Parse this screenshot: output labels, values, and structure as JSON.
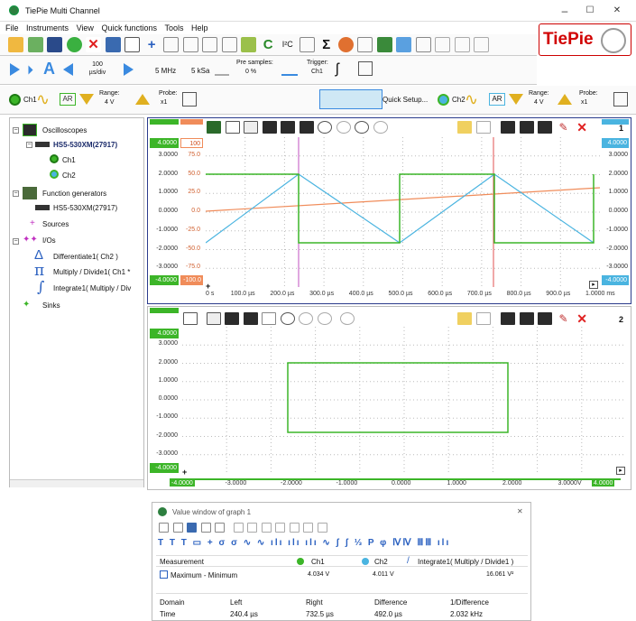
{
  "window": {
    "title": "TiePie Multi Channel",
    "controls": [
      "–",
      "☐",
      "✕"
    ]
  },
  "menu": [
    "File",
    "Instruments",
    "View",
    "Quick functions",
    "Tools",
    "Help"
  ],
  "logo_text": "TiePie",
  "timebase": {
    "record": "100\nµs/div",
    "rate": "5 MHz",
    "samples": "5 kSa",
    "pre_samples_label": "Pre samples:",
    "pre_samples_value": "0 %",
    "trigger_label": "Trigger:",
    "trigger_value": "Ch1"
  },
  "ch1": {
    "name": "Ch1",
    "coupling": "AR",
    "range_label": "Range:",
    "range_value": "4 V",
    "probe_label": "Probe:",
    "probe_value": "x1"
  },
  "ch2": {
    "name": "Ch2",
    "coupling": "AR",
    "range_label": "Range:",
    "range_value": "4 V",
    "probe_label": "Probe:",
    "probe_value": "x1"
  },
  "quick_setup": "Quick Setup...",
  "tree": {
    "oscilloscopes": "Oscilloscopes",
    "device1": "HS5-530XM(27917)",
    "ch1": "Ch1",
    "ch2": "Ch2",
    "function_generators": "Function generators",
    "device2": "HS5-530XM(27917)",
    "sources": "Sources",
    "ios": "I/Os",
    "differentiate": "Differentiate1( Ch2 )",
    "multiply": "Multiply / Divide1( Ch1 *",
    "integrate": "Integrate1( Multiply / Div",
    "sinks": "Sinks"
  },
  "graph1": {
    "number": "1",
    "left_top_tag": "4.0000",
    "left_top_tag2": "100",
    "right_top_tag": "4.0000",
    "left_bottom_tag": "-4.0000",
    "left_bottom_tag2": "-100.0",
    "right_bottom_tag": "-4.0000",
    "yticks_left": [
      "3.0000",
      "2.0000",
      "1.0000",
      "0.0000",
      "-1.0000",
      "-2.0000",
      "-3.0000"
    ],
    "yticks_mid": [
      "75.0",
      "50.0",
      "25.0",
      "0.0",
      "-25.0",
      "-50.0",
      "-75.0"
    ],
    "yticks_right": [
      "3.0000",
      "2.0000",
      "1.0000",
      "0.0000",
      "-1.0000",
      "-2.0000",
      "-3.0000"
    ],
    "xticks": [
      "0 s",
      "100.0 µs",
      "200.0 µs",
      "300.0 µs",
      "400.0 µs",
      "500.0 µs",
      "600.0 µs",
      "700.0 µs",
      "800.0 µs",
      "900.0 µs",
      "1.0000 ms"
    ]
  },
  "graph2": {
    "number": "2",
    "top_tag": "4.0000",
    "bottom_tag": "-4.0000",
    "yticks": [
      "3.0000",
      "2.0000",
      "1.0000",
      "0.0000",
      "-1.0000",
      "-2.0000",
      "-3.0000"
    ],
    "xticks": [
      "-4.0000",
      "-3.0000",
      "-2.0000",
      "-1.0000",
      "0.0000",
      "1.0000",
      "2.0000",
      "3.0000",
      "V",
      "4.0000"
    ]
  },
  "value_window": {
    "title": "Value window of graph 1",
    "header_measurement": "Measurement",
    "header_ch1": "Ch1",
    "header_ch2": "Ch2",
    "header_int": "Integrate1( Multiply / Divide1 )",
    "row_label": "Maximum - Minimum",
    "row_ch1": "4.034 V",
    "row_ch2": "4.011 V",
    "row_int": "16.061 V²",
    "cursor_headers": [
      "Domain",
      "Left",
      "Right",
      "Difference",
      "1/Difference"
    ],
    "cursor_values": [
      "Time",
      "240.4 µs",
      "732.5 µs",
      "492.0 µs",
      "2.032 kHz"
    ]
  },
  "colors": {
    "ch1": "#3cb528",
    "ch2": "#4ab4e0",
    "math": "#f08c5a",
    "accent": "#2b3c8c",
    "tiepie_red": "#d10000"
  }
}
